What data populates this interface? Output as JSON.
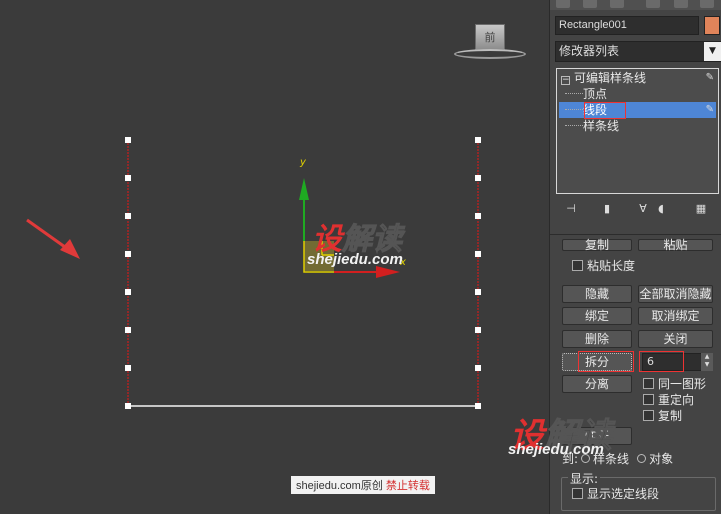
{
  "viewport": {
    "viewcube_label": "前",
    "gizmo": {
      "y_label": "y",
      "x_label": "x"
    },
    "watermark_center": {
      "red_char": "设",
      "rest": "解读",
      "sub": "shejiedu.com"
    },
    "watermark_lower": {
      "red_char": "设",
      "rest": "解读",
      "sub": "shejiedu.com"
    },
    "credit": {
      "site": "shejiedu.com原创",
      "warning": "禁止转载"
    },
    "colors": {
      "arrow": "#e03a3a",
      "segment_line": "#b02323",
      "gizmo_y": "#1faa22",
      "gizmo_x": "#d21f1f",
      "gizmo_box": "#e0d000"
    }
  },
  "panel": {
    "object_name": "Rectangle001",
    "object_color": "#e0845a",
    "modifier_list": "修改器列表",
    "stack": {
      "root": "可编辑样条线",
      "items": [
        "顶点",
        "线段",
        "样条线"
      ],
      "selected": "线段"
    },
    "buttons": {
      "copy": "复制",
      "paste": "粘贴",
      "paste_length": "粘贴长度",
      "hide": "隐藏",
      "unhide_all": "全部取消隐藏",
      "bind": "绑定",
      "unbind": "取消绑定",
      "delete": "删除",
      "close": "关闭",
      "divide": "拆分",
      "divide_value": "6",
      "detach": "分离",
      "same_shape": "同一图形",
      "reorient": "重定向",
      "copy_opt": "复制",
      "partial_btn": "炸开",
      "to_label": "到:",
      "to_spline": "样条线",
      "to_object": "对象"
    },
    "display": {
      "title": "显示:",
      "show_selected_segments": "显示选定线段"
    }
  }
}
